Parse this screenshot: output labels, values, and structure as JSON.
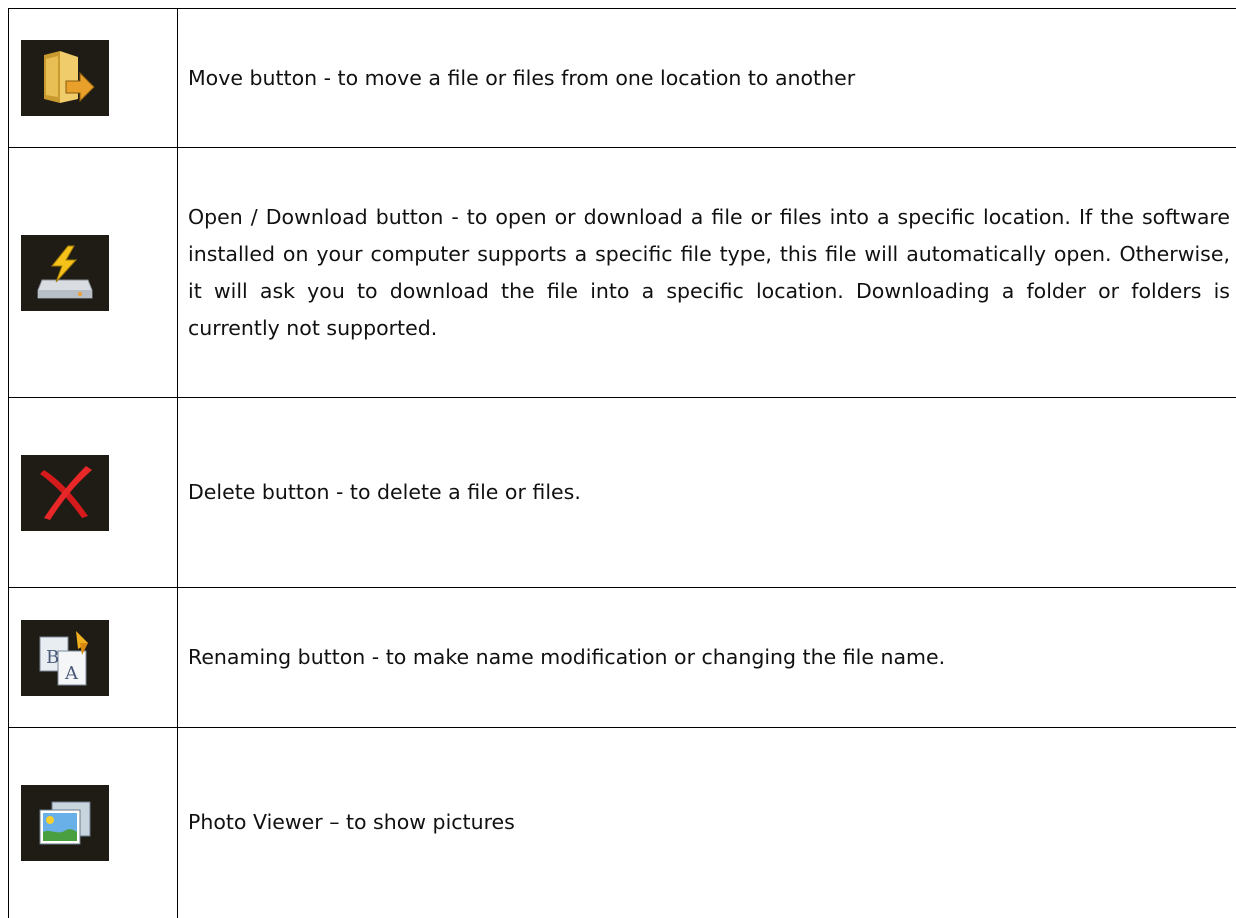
{
  "rows": [
    {
      "icon": "move-folder-icon",
      "text": "Move button - to move a file or files from one location to another"
    },
    {
      "icon": "download-drive-icon",
      "text": "Open / Download button - to open or download a file or files into a specific location.  If the software installed on your computer supports a specific file type, this file will automatically open. Otherwise, it will ask you to download the file into a specific location. Downloading a folder or folders is currently not supported."
    },
    {
      "icon": "red-x-delete-icon",
      "text": "Delete button - to delete a file or files."
    },
    {
      "icon": "rename-ba-icon",
      "text": "Renaming button - to make name modification or changing the file name."
    },
    {
      "icon": "photo-viewer-icon",
      "text": "Photo Viewer – to show pictures"
    }
  ],
  "colors": {
    "icon_background": "#1e1c14",
    "border": "#000000",
    "text": "#111111"
  }
}
